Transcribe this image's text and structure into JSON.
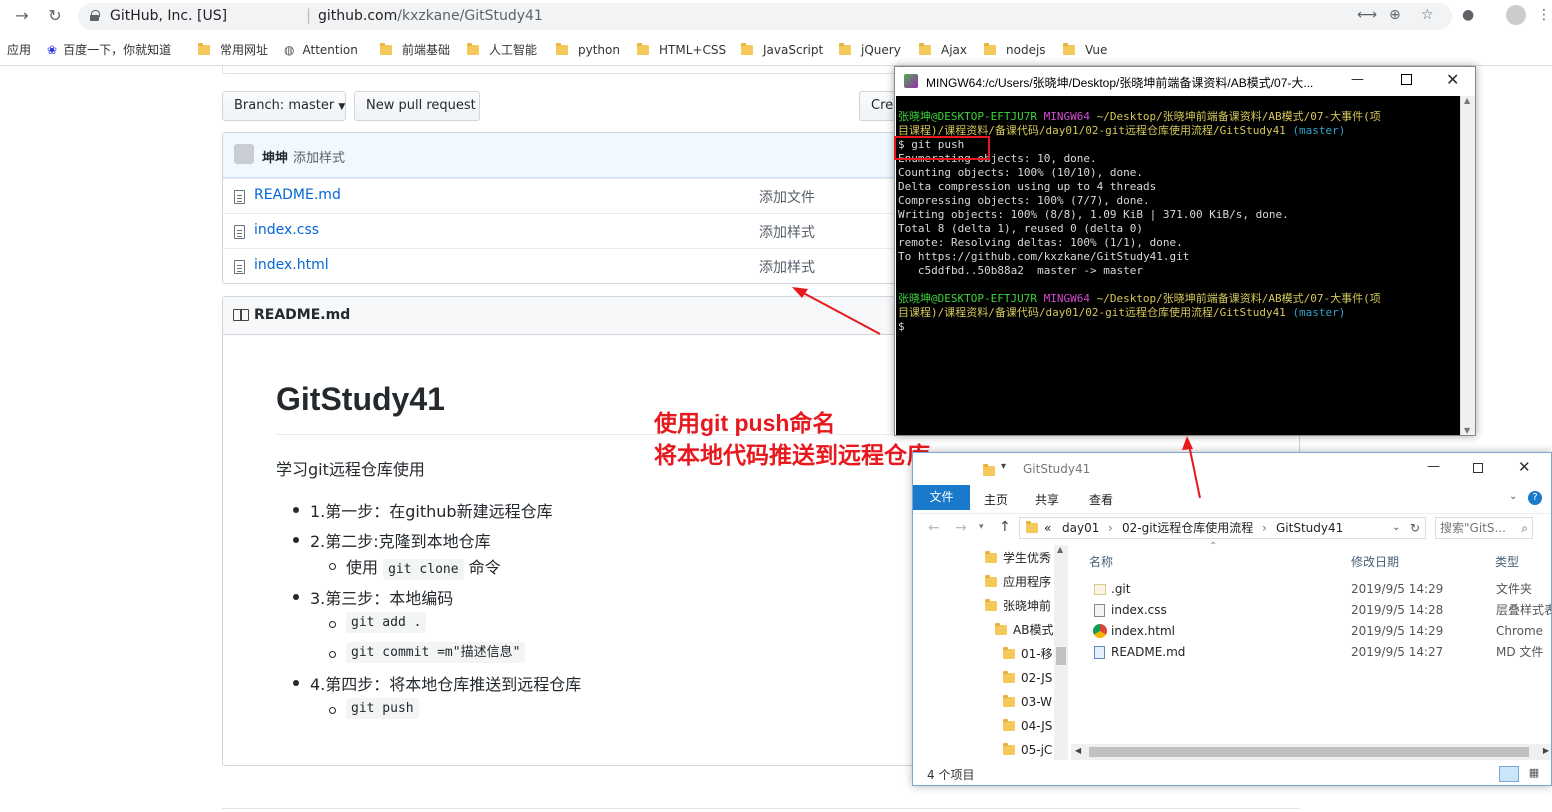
{
  "browser": {
    "org": "GitHub, Inc. [US]",
    "url_host": "github.com",
    "url_path": "/kxzkane/GitStudy41",
    "apps_label": "应用",
    "bookmarks": [
      "百度一下，你就知道",
      "常用网址",
      "Attention",
      "前端基础",
      "人工智能",
      "python",
      "HTML+CSS",
      "JavaScript",
      "jQuery",
      "Ajax",
      "nodejs",
      "Vue"
    ]
  },
  "repo": {
    "branch_label": "Branch: master",
    "new_pr_label": "New pull request",
    "create_label": "Crea",
    "commit_author": "坤坤",
    "commit_message": "添加样式",
    "files": [
      {
        "name": "README.md",
        "message": "添加文件"
      },
      {
        "name": "index.css",
        "message": "添加样式"
      },
      {
        "name": "index.html",
        "message": "添加样式"
      }
    ]
  },
  "readme": {
    "header": "README.md",
    "title": "GitStudy41",
    "intro": "学习git远程仓库使用",
    "step1": "1.第一步：在github新建远程仓库",
    "step2": "2.第二步:克隆到本地仓库",
    "step2_sub_pre": "使用",
    "step2_sub_code": "git clone",
    "step2_sub_post": "命令",
    "step3": "3.第三步：本地编码",
    "step3_code1": "git add .",
    "step3_code2": "git commit =m\"描述信息\"",
    "step4": "4.第四步：将本地仓库推送到远程仓库",
    "step4_code": "git push"
  },
  "annotation": {
    "line1": "使用git push命名",
    "line2": "将本地代码推送到远程仓库",
    "color": "#e8191e"
  },
  "terminal": {
    "title": "MINGW64:/c/Users/张晓坤/Desktop/张晓坤前端备课资料/AB模式/07-大...",
    "prompt_user": "张晓坤@DESKTOP-EFTJU7R",
    "prompt_env": "MINGW64",
    "prompt_path1": "~/Desktop/张晓坤前端备课资料/AB模式/07-大事件(项",
    "prompt_path2": "目课程)/课程资料/备课代码/day01/02-git远程仓库使用流程/GitStudy41",
    "prompt_branch": "(master)",
    "command": "$ git push",
    "output": [
      "Enumerating objects: 10, done.",
      "Counting objects: 100% (10/10), done.",
      "Delta compression using up to 4 threads",
      "Compressing objects: 100% (7/7), done.",
      "Writing objects: 100% (8/8), 1.09 KiB | 371.00 KiB/s, done.",
      "Total 8 (delta 1), reused 0 (delta 0)",
      "remote: Resolving deltas: 100% (1/1), done.",
      "To https://github.com/kxzkane/GitStudy41.git",
      "   c5ddfbd..50b88a2  master -> master"
    ],
    "final_prompt": "$"
  },
  "explorer": {
    "title": "GitStudy41",
    "tabs": [
      "文件",
      "主页",
      "共享",
      "查看"
    ],
    "breadcrumb": [
      "«",
      "day01",
      "02-git远程仓库使用流程",
      "GitStudy41"
    ],
    "search_placeholder": "搜索\"GitS...",
    "tree": [
      "学生优秀",
      "应用程序",
      "张晓坤前",
      "AB模式",
      "01-移",
      "02-JS",
      "03-W",
      "04-JS",
      "05-jC"
    ],
    "columns": {
      "name": "名称",
      "date": "修改日期",
      "type": "类型"
    },
    "rows": [
      {
        "name": ".git",
        "date": "2019/9/5 14:29",
        "type": "文件夹"
      },
      {
        "name": "index.css",
        "date": "2019/9/5 14:28",
        "type": "层叠样式表"
      },
      {
        "name": "index.html",
        "date": "2019/9/5 14:29",
        "type": "Chrome"
      },
      {
        "name": "README.md",
        "date": "2019/9/5 14:27",
        "type": "MD 文件"
      }
    ],
    "status": "4 个项目"
  }
}
